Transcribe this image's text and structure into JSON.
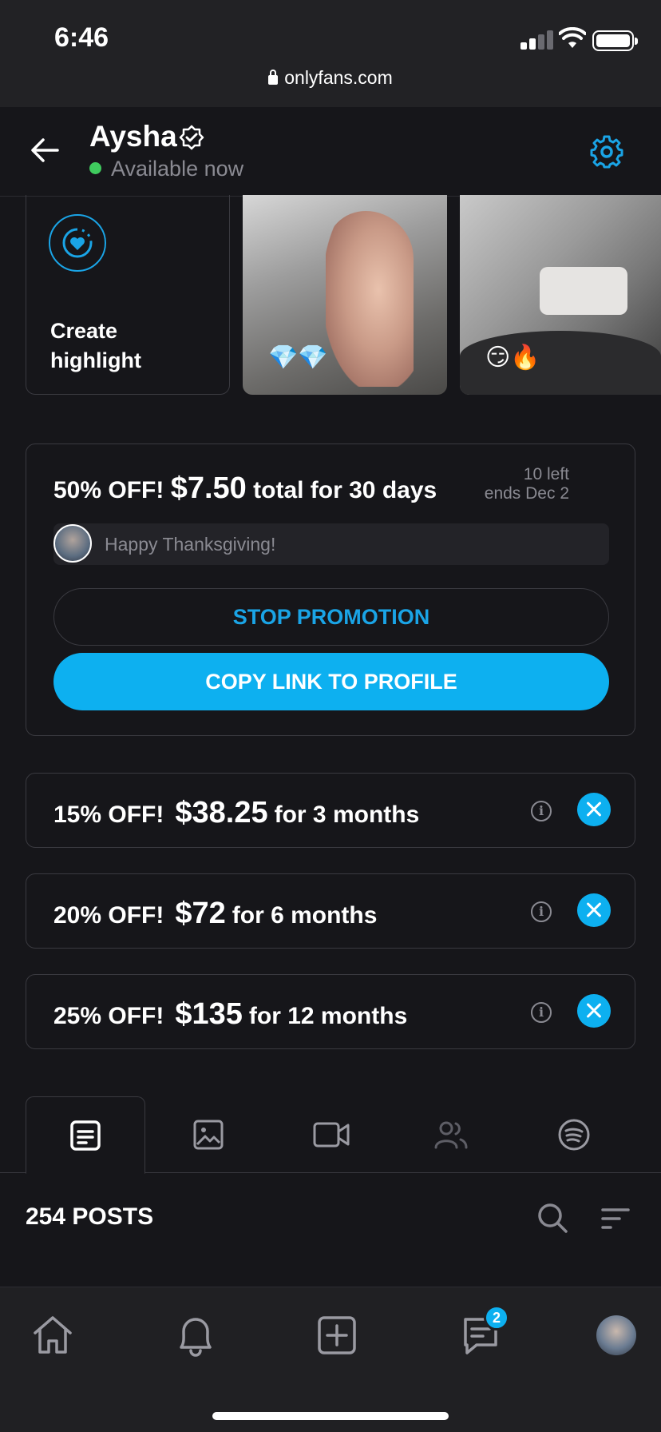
{
  "status": {
    "time": "6:46"
  },
  "browser": {
    "url": "onlyfans.com"
  },
  "header": {
    "name": "Aysha",
    "status": "Available now"
  },
  "highlights": {
    "create_label": "Create highlight",
    "items": [
      {
        "emoji": "💎💎"
      },
      {
        "emoji": "😏🔥"
      }
    ]
  },
  "promotion": {
    "discount": "50% OFF!",
    "price": "$7.50",
    "terms": "total for 30 days",
    "left": "10 left",
    "ends": "ends Dec 2",
    "message": "Happy Thanksgiving!",
    "stop_label": "STOP PROMOTION",
    "copy_label": "COPY LINK TO PROFILE"
  },
  "bundles": [
    {
      "discount": "15% OFF!",
      "price": "$38.25",
      "term": "for 3 months",
      "info": "i"
    },
    {
      "discount": "20% OFF!",
      "price": "$72",
      "term": "for 6 months",
      "info": "i"
    },
    {
      "discount": "25% OFF!",
      "price": "$135",
      "term": "for 12 months",
      "info": "i"
    }
  ],
  "tabs": [
    {
      "icon": "posts-icon",
      "active": true
    },
    {
      "icon": "photo-icon"
    },
    {
      "icon": "video-icon"
    },
    {
      "icon": "people-icon"
    },
    {
      "icon": "spotify-icon"
    }
  ],
  "posts": {
    "count_label": "254 POSTS"
  },
  "bottom_nav": {
    "items": [
      "home-icon",
      "bell-icon",
      "add-icon",
      "messages-icon",
      "avatar"
    ],
    "messages_badge": "2"
  },
  "colors": {
    "accent": "#0db0f0",
    "background": "#16161a",
    "online": "#3fcb5e"
  }
}
